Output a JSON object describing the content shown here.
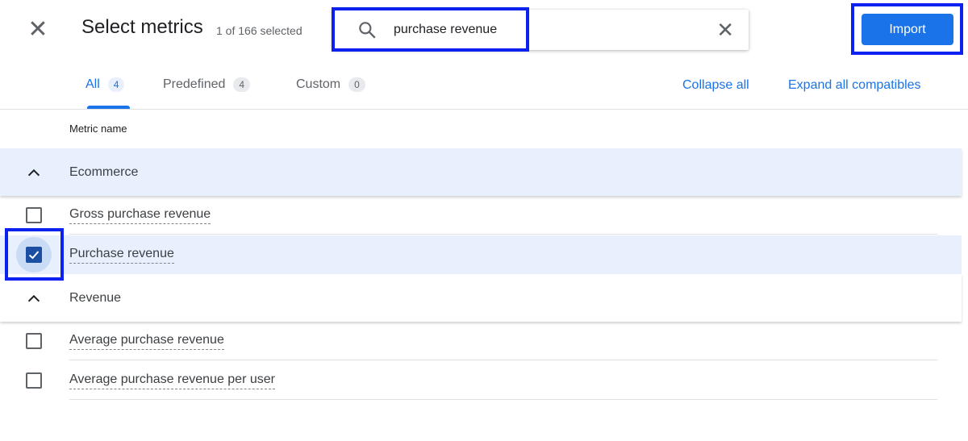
{
  "header": {
    "title": "Select metrics",
    "selection_count": "1 of 166 selected",
    "import_label": "Import"
  },
  "search": {
    "value": "purchase revenue"
  },
  "tabs": [
    {
      "label": "All",
      "count": "4",
      "active": true
    },
    {
      "label": "Predefined",
      "count": "4"
    },
    {
      "label": "Custom",
      "count": "0"
    }
  ],
  "actions": {
    "collapse_all": "Collapse all",
    "expand_all": "Expand all compatibles"
  },
  "table": {
    "column_header": "Metric name"
  },
  "groups": [
    {
      "name": "Ecommerce",
      "expanded": true,
      "metrics": [
        {
          "name": "Gross purchase revenue",
          "checked": false
        },
        {
          "name": "Purchase revenue",
          "checked": true
        }
      ]
    },
    {
      "name": "Revenue",
      "expanded": true,
      "metrics": [
        {
          "name": "Average purchase revenue",
          "checked": false
        },
        {
          "name": "Average purchase revenue per user",
          "checked": false
        }
      ]
    }
  ],
  "colors": {
    "accent": "#1a73e8",
    "selected_row": "#e8f0fe",
    "highlight_box": "#0a21ef"
  }
}
